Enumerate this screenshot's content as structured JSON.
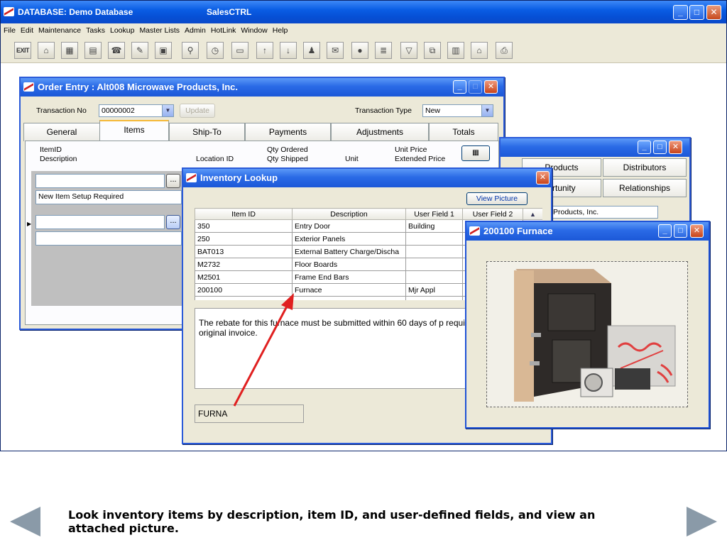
{
  "app": {
    "title": "DATABASE:  Demo Database",
    "product": "SalesCTRL",
    "menu": [
      "File",
      "Edit",
      "Maintenance",
      "Tasks",
      "Lookup",
      "Master Lists",
      "Admin",
      "HotLink",
      "Window",
      "Help"
    ],
    "toolbar": [
      {
        "name": "exit-icon",
        "glyph": "EXIT"
      },
      {
        "name": "open-icon",
        "glyph": "⌂"
      },
      {
        "name": "contacts-icon",
        "glyph": "▦"
      },
      {
        "name": "calendar-icon",
        "glyph": "▤"
      },
      {
        "name": "phone-icon",
        "glyph": "☎"
      },
      {
        "name": "notes-icon",
        "glyph": "✎"
      },
      {
        "name": "forms-icon",
        "glyph": "▣"
      },
      {
        "name": "binoculars-icon",
        "glyph": "⚲"
      },
      {
        "name": "clock-icon",
        "glyph": "◷"
      },
      {
        "name": "window-icon",
        "glyph": "▭"
      },
      {
        "name": "up-arrow-icon",
        "glyph": "↑"
      },
      {
        "name": "down-arrow-icon",
        "glyph": "↓"
      },
      {
        "name": "user-icon",
        "glyph": "♟"
      },
      {
        "name": "mail-icon",
        "glyph": "✉"
      },
      {
        "name": "record-icon",
        "glyph": "●"
      },
      {
        "name": "report-icon",
        "glyph": "≣"
      },
      {
        "name": "filter-icon",
        "glyph": "▽"
      },
      {
        "name": "network-icon",
        "glyph": "⧉"
      },
      {
        "name": "book-icon",
        "glyph": "▥"
      },
      {
        "name": "building-icon",
        "glyph": "⌂"
      },
      {
        "name": "print-icon",
        "glyph": "⎙"
      }
    ]
  },
  "order": {
    "title": "Order Entry : Alt008    Microwave Products, Inc.",
    "transaction_no_label": "Transaction No",
    "transaction_no": "00000002",
    "update_label": "Update",
    "transaction_type_label": "Transaction Type",
    "transaction_type": "New",
    "tabs": [
      "General",
      "Items",
      "Ship-To",
      "Payments",
      "Adjustments",
      "Totals"
    ],
    "headers": {
      "item_id": "ItemID",
      "description": "Description",
      "location_id": "Location ID",
      "qty_ordered": "Qty Ordered",
      "qty_shipped": "Qty Shipped",
      "unit": "Unit",
      "unit_price": "Unit Price",
      "extended_price": "Extended Price"
    },
    "row1_note": "New Item Setup Required",
    "ellipsis": "..."
  },
  "contact": {
    "tabs": [
      "Products",
      "Distributors",
      "ortunity",
      "Relationships"
    ],
    "company": "Products, Inc."
  },
  "inventory": {
    "title": "Inventory Lookup",
    "view_picture_label": "View Picture",
    "columns": [
      "Item ID",
      "Description",
      "User Field 1",
      "User Field 2"
    ],
    "rows": [
      [
        "350",
        "Entry Door",
        "Building",
        ""
      ],
      [
        "250",
        "Exterior Panels",
        "",
        ""
      ],
      [
        "BAT013",
        "External Battery Charge/Discha",
        "",
        ""
      ],
      [
        "M2732",
        "Floor Boards",
        "",
        ""
      ],
      [
        "M2501",
        "Frame End Bars",
        "",
        ""
      ],
      [
        "200100",
        "Furnace",
        "Mjr Appl",
        ""
      ]
    ],
    "memo": "The rebate for this furnace must be submitted within 60 days of p requires a copy of the original invoice.",
    "search": "FURNA"
  },
  "picture": {
    "title": "200100 Furnace"
  },
  "caption": "Look inventory items by description, item ID, and user-defined fields, and view an attached picture.",
  "colors": {
    "xp_title": "#0a5de4",
    "arrow": "#e02020",
    "nav_arrow": "#8a9aa8"
  }
}
